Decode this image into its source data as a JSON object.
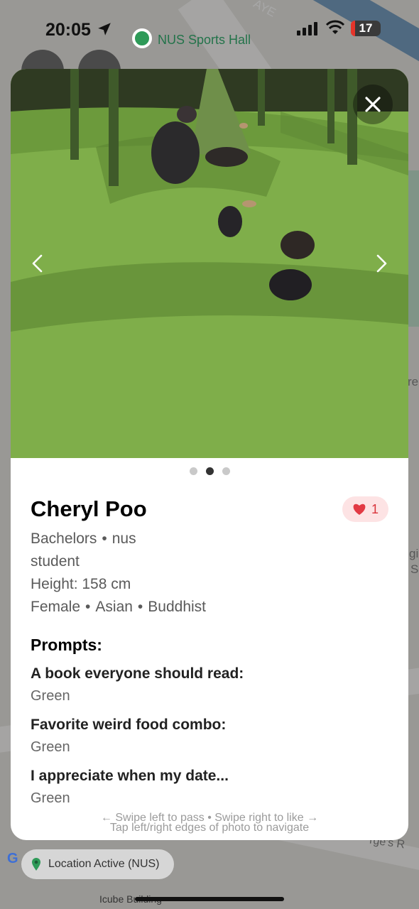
{
  "status_bar": {
    "time": "20:05",
    "battery": "17"
  },
  "map": {
    "place_name": "NUS Sports Hall",
    "road_label": "AYE",
    "bottom_label": "Icube Building",
    "location_status": "Location Active (NUS)",
    "google_logo": "G",
    "edge_label_1": "re",
    "edge_label_2": "gi",
    "edge_label_3": "S",
    "edge_label_4": "rge's R"
  },
  "profile": {
    "name": "Cheryl Poo",
    "likes": "1",
    "education": "Bachelors",
    "school": "nus",
    "occupation": "student",
    "height": "Height: 158 cm",
    "gender": "Female",
    "ethnicity": "Asian",
    "religion": "Buddhist",
    "separator": "•"
  },
  "photos": {
    "count": 3,
    "active_index": 1
  },
  "prompts": {
    "title": "Prompts:",
    "items": [
      {
        "question": "A book everyone should read:",
        "answer": "Green"
      },
      {
        "question": "Favorite weird food combo:",
        "answer": "Green"
      },
      {
        "question": "I appreciate when my date...",
        "answer": "Green"
      }
    ]
  },
  "hints": {
    "swipe": "← Swipe left to pass • Swipe right to like →",
    "tap": "Tap left/right edges of photo to navigate"
  },
  "icons": {
    "close": "close-icon",
    "prev": "chevron-left-icon",
    "next": "chevron-right-icon",
    "heart": "heart-icon",
    "pin": "map-pin-icon"
  },
  "colors": {
    "like": "#d9343b",
    "like_bg": "#fde3e4",
    "grass": "#7fae4a"
  }
}
